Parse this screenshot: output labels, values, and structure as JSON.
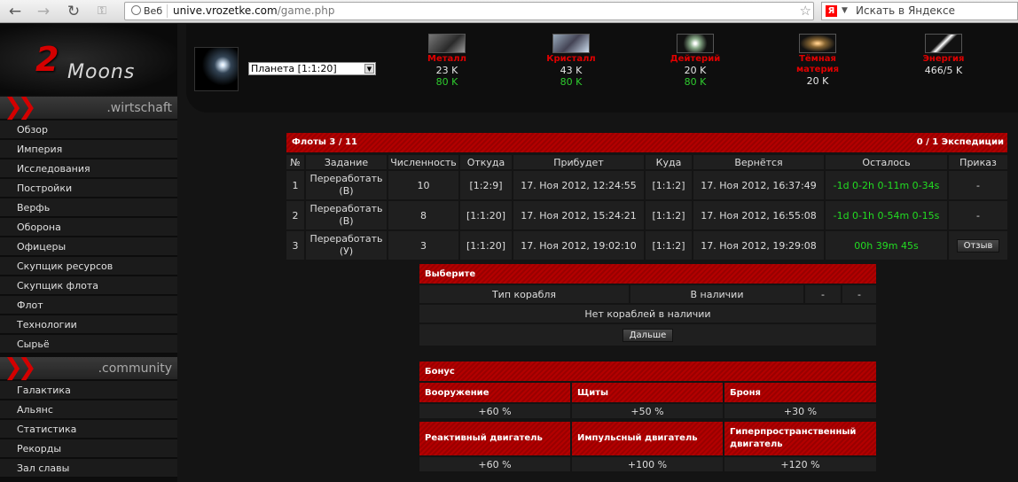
{
  "browser": {
    "site_label": "Веб",
    "url_host": "unive.vrozetke.com",
    "url_path": "/game.php",
    "search_placeholder": "Искать в Яндексе",
    "search_logo": "Я"
  },
  "logo": {
    "num": "2",
    "word": "Moons"
  },
  "sidebar": {
    "sections": [
      {
        "title": ".wirtschaft"
      },
      {
        "title": ".community"
      }
    ],
    "economy": [
      "Обзор",
      "Империя",
      "Исследования",
      "Постройки",
      "Верфь",
      "Оборона",
      "Офицеры",
      "Скупщик ресурсов",
      "Скупщик флота",
      "Флот",
      "Технологии",
      "Сырьё"
    ],
    "community": [
      "Галактика",
      "Альянс",
      "Статистика",
      "Рекорды",
      "Зал славы"
    ]
  },
  "planet": {
    "selected": "Планета [1:1:20]"
  },
  "resources": [
    {
      "name": "Металл",
      "amount": "23 K",
      "prod": "80 K"
    },
    {
      "name": "Кристалл",
      "amount": "43 K",
      "prod": "80 K"
    },
    {
      "name": "Дейтерий",
      "amount": "20 K",
      "prod": "80 K"
    },
    {
      "name": "Тёмная материя",
      "amount": "20 K",
      "prod": ""
    },
    {
      "name": "Энергия",
      "amount": "466/5 K",
      "prod": ""
    }
  ],
  "fleets": {
    "title": "Флоты 3 / 11",
    "expeditions": "0 / 1 Экспедиции",
    "columns": [
      "№",
      "Задание",
      "Численность",
      "Откуда",
      "Прибудет",
      "Куда",
      "Вернётся",
      "Осталось",
      "Приказ"
    ],
    "rows": [
      {
        "num": "1",
        "mission": "Переработать\n(В)",
        "count": "10",
        "from": "[1:2:9]",
        "arrive": "17. Ноя 2012, 12:24:55",
        "to": "[1:1:2]",
        "back": "17. Ноя 2012, 16:37:49",
        "left": "-1d 0-2h 0-11m 0-34s",
        "order": "-"
      },
      {
        "num": "2",
        "mission": "Переработать\n(В)",
        "count": "8",
        "from": "[1:1:20]",
        "arrive": "17. Ноя 2012, 15:24:21",
        "to": "[1:1:2]",
        "back": "17. Ноя 2012, 16:55:08",
        "left": "-1d 0-1h 0-54m 0-15s",
        "order": "-"
      },
      {
        "num": "3",
        "mission": "Переработать\n(У)",
        "count": "3",
        "from": "[1:1:20]",
        "arrive": "17. Ноя 2012, 19:02:10",
        "to": "[1:1:2]",
        "back": "17. Ноя 2012, 19:29:08",
        "left": "00h 39m 45s",
        "order": "Отзыв"
      }
    ]
  },
  "choose": {
    "title": "Выберите",
    "col_type": "Тип корабля",
    "col_avail": "В наличии",
    "col_min": "-",
    "col_max": "-",
    "empty": "Нет кораблей в наличии",
    "next": "Дальше"
  },
  "bonus": {
    "title": "Бонус",
    "items": [
      {
        "label": "Вооружение",
        "value": "+60 %"
      },
      {
        "label": "Щиты",
        "value": "+50 %"
      },
      {
        "label": "Броня",
        "value": "+30 %"
      },
      {
        "label": "Реактивный двигатель",
        "value": "+60 %"
      },
      {
        "label": "Импульсный двигатель",
        "value": "+100 %"
      },
      {
        "label": "Гиперпространственный двигатель",
        "value": "+120 %"
      }
    ]
  },
  "colors": {
    "accent_red": "#b30000",
    "prod_green": "#2ecc2e",
    "timer_green": "#22dd22"
  }
}
